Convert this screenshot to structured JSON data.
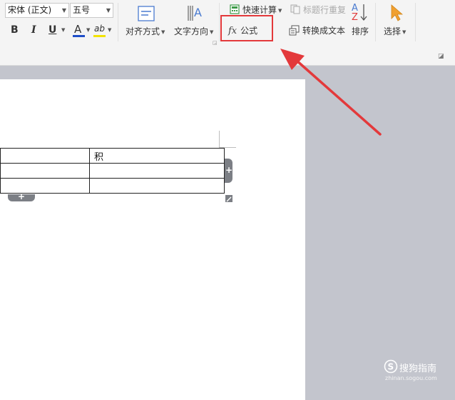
{
  "toolbar": {
    "font_name": "宋体 (正文)",
    "font_size": "五号",
    "bold": "B",
    "italic": "I",
    "underline": "U",
    "font_color_glyph": "A",
    "highlight_glyph": "ab",
    "align_label": "对齐方式",
    "text_direction_label": "文字方向",
    "quick_calc_label": "快速计算",
    "title_repeat_label": "标题行重复",
    "sort_glyph_top": "A",
    "sort_glyph_bottom": "Z",
    "formula_fx": "fx",
    "formula_label": "公式",
    "convert_label": "转换成文本",
    "sort_label": "排序",
    "select_label": "选择"
  },
  "table": {
    "rows": [
      [
        "",
        "积"
      ],
      [
        "",
        ""
      ],
      [
        "",
        ""
      ]
    ]
  },
  "watermark": {
    "brand": "搜狗指南",
    "url": "zhinan.sogou.com"
  },
  "colors": {
    "highlight_border": "#e3393b",
    "arrow": "#e3393b",
    "font_color_bar": "#1f4ec8",
    "highlight_bar": "#f2e200"
  }
}
